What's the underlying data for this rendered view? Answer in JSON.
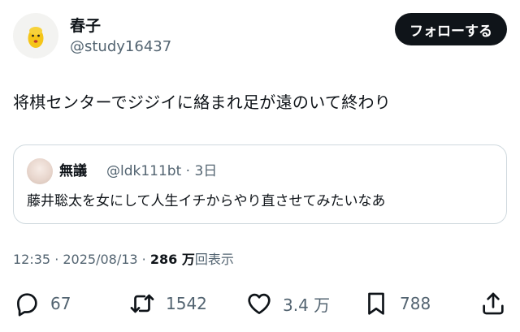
{
  "author": {
    "display_name": "春子",
    "handle": "@study16437",
    "follow_label": "フォローする"
  },
  "post": {
    "text": "将棋センターでジジイに絡まれ足が遠のいて終わり"
  },
  "quoted_post": {
    "display_name": "無議",
    "handle_time": "@ldk111bt · 3日",
    "text": "藤井聡太を女にして人生イチからやり直させてみたいなあ"
  },
  "timestamp": {
    "time_date": "12:35 · 2025/08/13 · ",
    "views_count": "286 万",
    "views_label": "回表示"
  },
  "actions": {
    "replies": "67",
    "reposts": "1542",
    "likes": "3.4 万",
    "bookmarks": "788"
  },
  "colors": {
    "text_primary": "#0f1419",
    "text_secondary": "#536471",
    "border": "#cfd9de",
    "button_bg": "#0f1419"
  },
  "icons": {
    "avatar": "yellow-face-avatar",
    "reply": "speech-bubble-icon",
    "repost": "repost-arrows-icon",
    "like": "heart-icon",
    "bookmark": "bookmark-icon",
    "share": "share-upload-icon"
  }
}
